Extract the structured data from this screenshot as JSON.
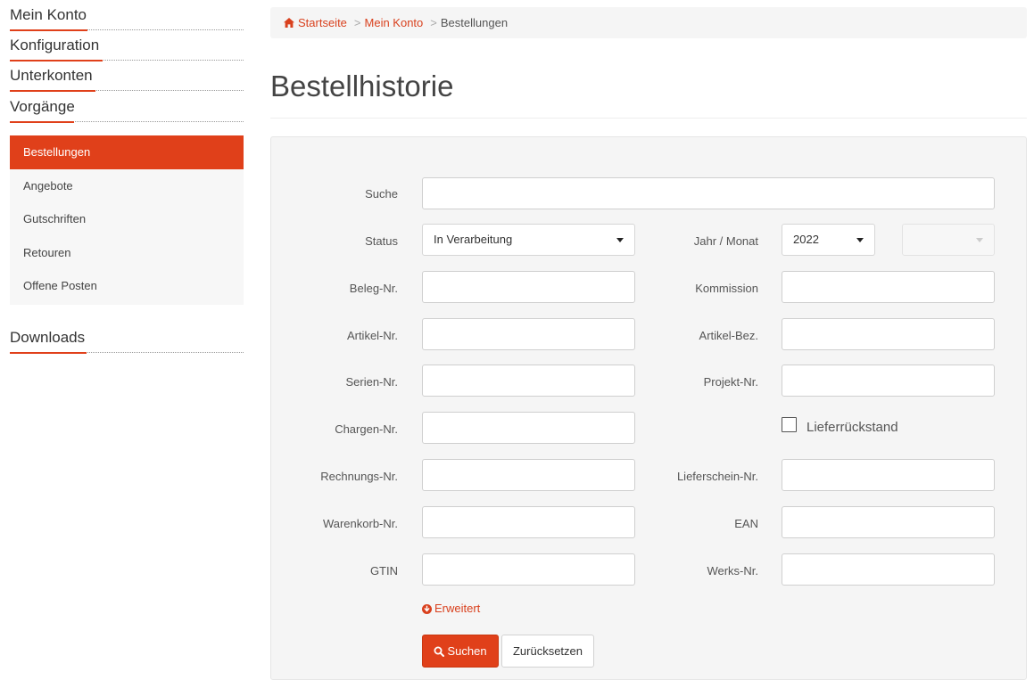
{
  "sidebar": {
    "sections": [
      {
        "label": "Mein Konto"
      },
      {
        "label": "Konfiguration"
      },
      {
        "label": "Unterkonten"
      },
      {
        "label": "Vorgänge"
      },
      {
        "label": "Downloads"
      }
    ],
    "sub_items": [
      {
        "label": "Bestellungen",
        "active": true
      },
      {
        "label": "Angebote"
      },
      {
        "label": "Gutschriften"
      },
      {
        "label": "Retouren"
      },
      {
        "label": "Offene Posten"
      }
    ]
  },
  "breadcrumb": {
    "home": "Startseite",
    "account": "Mein Konto",
    "current": "Bestellungen",
    "separator": ">"
  },
  "page": {
    "title": "Bestellhistorie"
  },
  "form": {
    "search": {
      "label": "Suche",
      "value": ""
    },
    "status": {
      "label": "Status",
      "value": "In Verarbeitung"
    },
    "year_month": {
      "label": "Jahr / Monat",
      "year": "2022",
      "month": ""
    },
    "beleg": {
      "label": "Beleg-Nr.",
      "value": ""
    },
    "kommission": {
      "label": "Kommission",
      "value": ""
    },
    "artikel_nr": {
      "label": "Artikel-Nr.",
      "value": ""
    },
    "artikel_bez": {
      "label": "Artikel-Bez.",
      "value": ""
    },
    "serien": {
      "label": "Serien-Nr.",
      "value": ""
    },
    "projekt": {
      "label": "Projekt-Nr.",
      "value": ""
    },
    "chargen": {
      "label": "Chargen-Nr.",
      "value": ""
    },
    "lieferrueckstand": {
      "label": "Lieferrückstand",
      "checked": false
    },
    "rechnung": {
      "label": "Rechnungs-Nr.",
      "value": ""
    },
    "lieferschein": {
      "label": "Lieferschein-Nr.",
      "value": ""
    },
    "warenkorb": {
      "label": "Warenkorb-Nr.",
      "value": ""
    },
    "ean": {
      "label": "EAN",
      "value": ""
    },
    "gtin": {
      "label": "GTIN",
      "value": ""
    },
    "werks": {
      "label": "Werks-Nr.",
      "value": ""
    },
    "advanced_label": "Erweitert",
    "search_button": "Suchen",
    "reset_button": "Zurücksetzen"
  },
  "colors": {
    "accent": "#e0401a",
    "link": "#d9411e"
  },
  "icons": [
    "home-icon",
    "search-icon",
    "circle-arrow-down-icon",
    "caret-down-icon"
  ]
}
